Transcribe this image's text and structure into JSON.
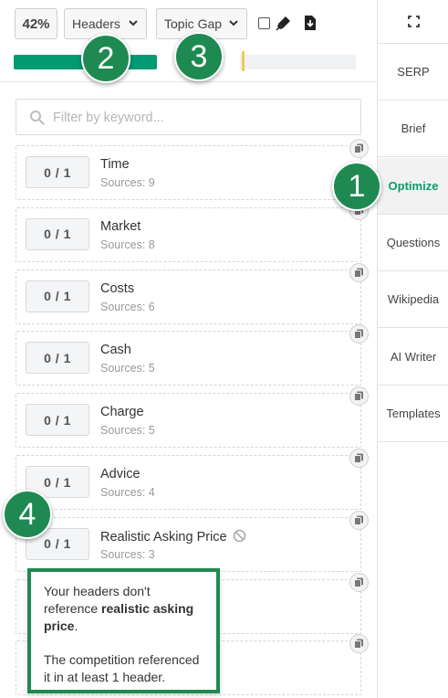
{
  "toolbar": {
    "score_percent": "42%",
    "view_dropdown": "Headers",
    "mode_dropdown": "Topic Gap",
    "progress_fraction": 0.42
  },
  "search": {
    "placeholder": "Filter by keyword...",
    "value": ""
  },
  "terms": [
    {
      "score": "0 / 1",
      "term": "Time",
      "sources": "Sources: 9"
    },
    {
      "score": "0 / 1",
      "term": "Market",
      "sources": "Sources: 8"
    },
    {
      "score": "0 / 1",
      "term": "Costs",
      "sources": "Sources: 6"
    },
    {
      "score": "0 / 1",
      "term": "Cash",
      "sources": "Sources: 5"
    },
    {
      "score": "0 / 1",
      "term": "Charge",
      "sources": "Sources: 5"
    },
    {
      "score": "0 / 1",
      "term": "Advice",
      "sources": "Sources: 4"
    },
    {
      "score": "0 / 1",
      "term": "Realistic Asking Price",
      "sources": "Sources: 3"
    },
    {
      "score": "",
      "term": "",
      "sources": ""
    },
    {
      "score": "",
      "term": "",
      "sources": ""
    }
  ],
  "sidebar": {
    "items": [
      {
        "label": "SERP"
      },
      {
        "label": "Brief"
      },
      {
        "label": "Optimize"
      },
      {
        "label": "Questions"
      },
      {
        "label": "Wikipedia"
      },
      {
        "label": "AI Writer"
      },
      {
        "label": "Templates"
      }
    ],
    "active_index": 2
  },
  "badges": [
    "1",
    "2",
    "3",
    "4"
  ],
  "tooltip": {
    "line1_pre": "Your headers don't reference ",
    "line1_bold": "realistic asking price",
    "line1_post": ".",
    "line2": "The competition referenced it in at least 1 header."
  },
  "colors": {
    "accent_green": "#009b72",
    "badge_green": "#1e8a52",
    "active_text": "#0a9b6b",
    "progress_marker": "#f2c94c"
  }
}
